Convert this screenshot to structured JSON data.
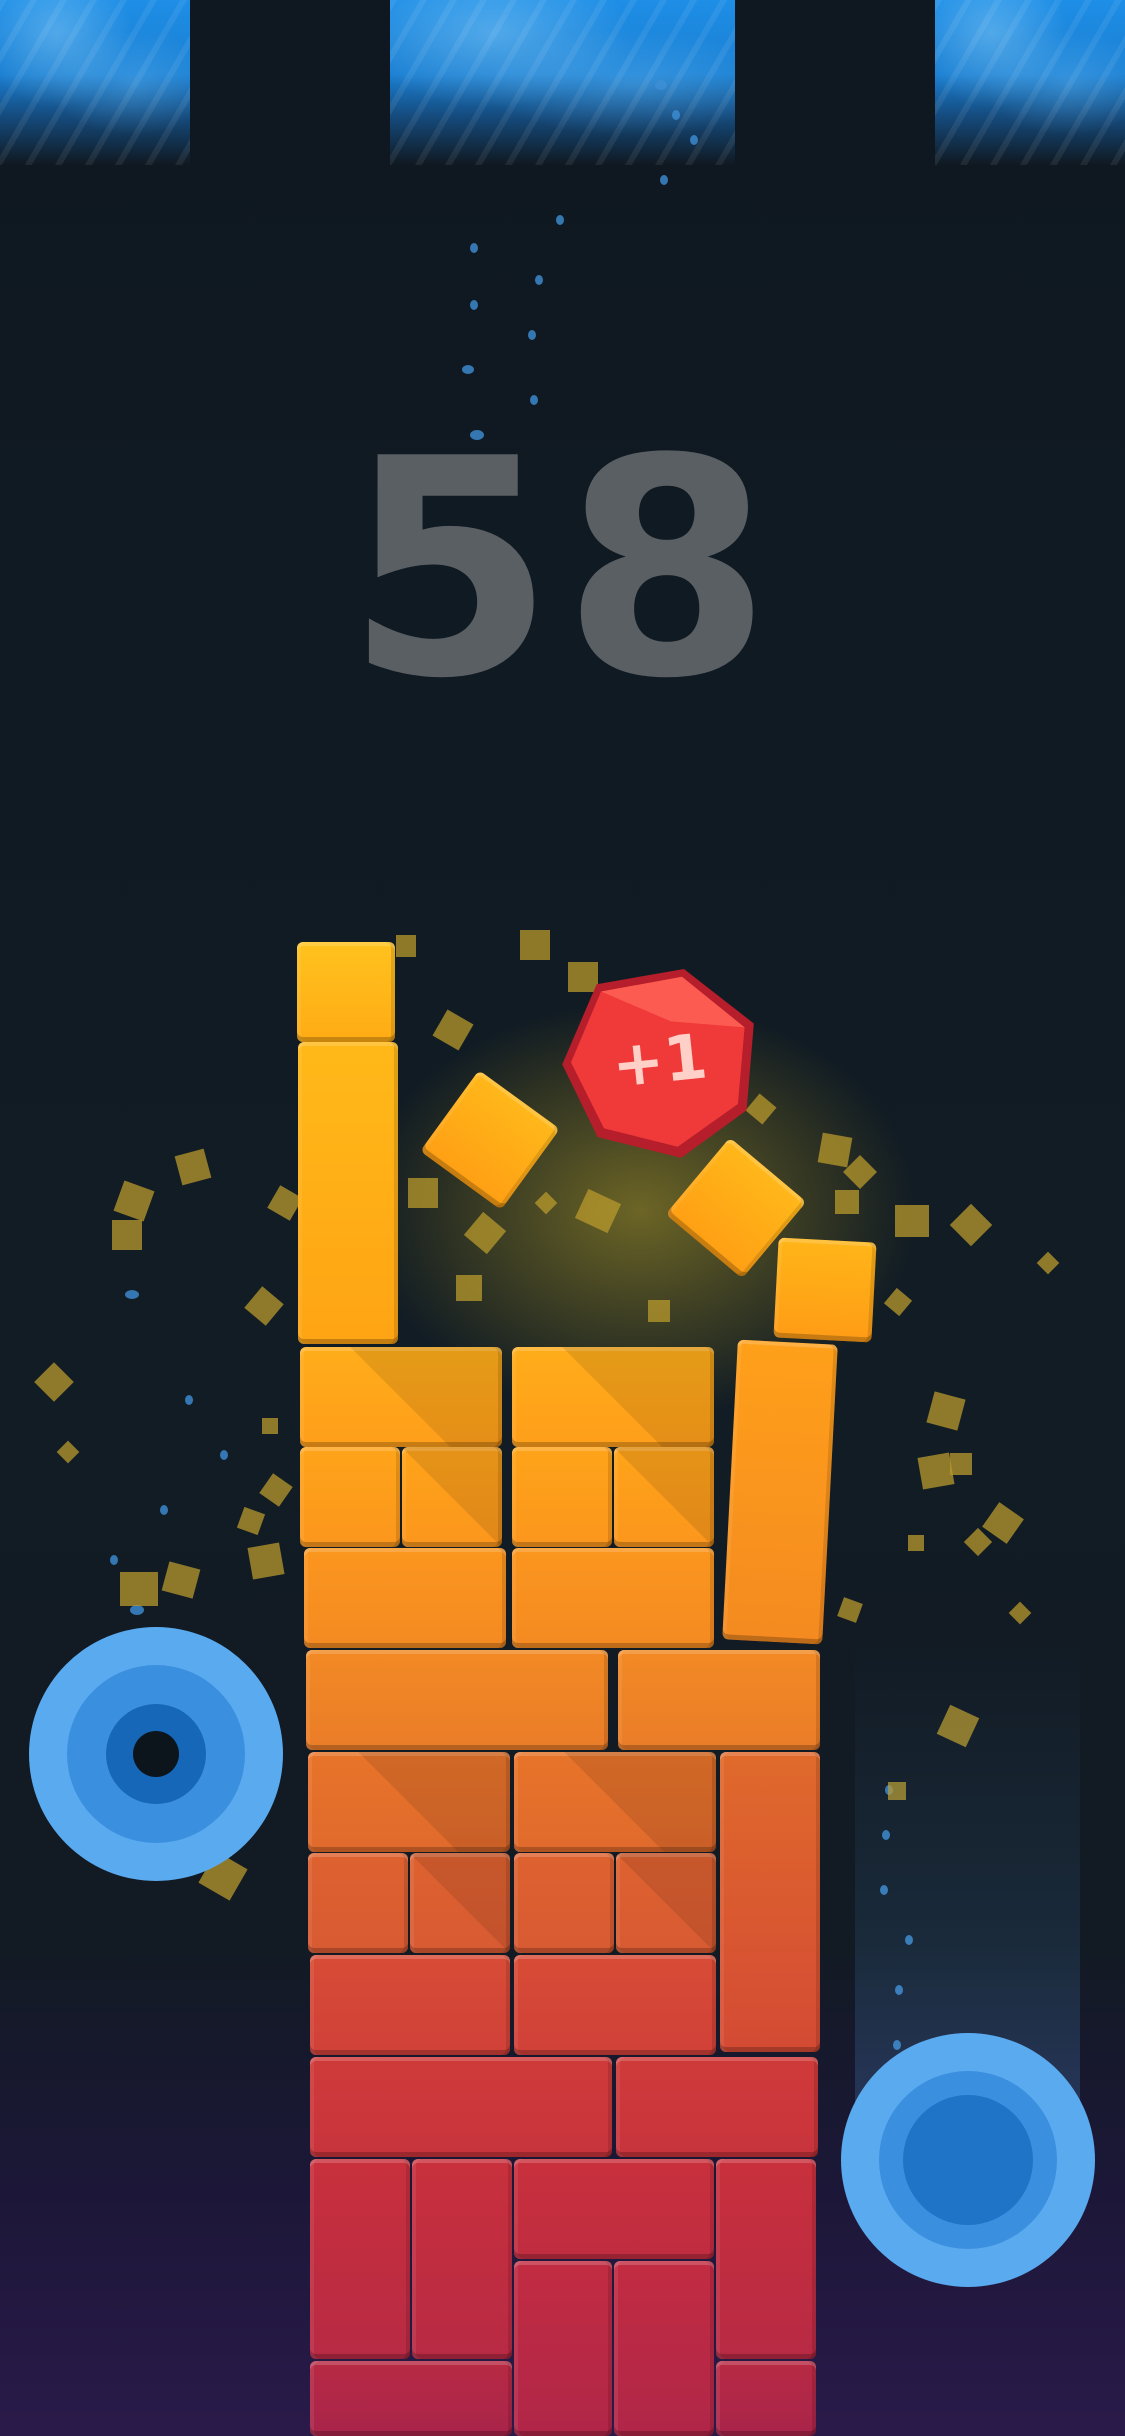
{
  "game": {
    "score": "58",
    "bonus_label": "+1"
  },
  "colors": {
    "background": "#101a22",
    "water": "#1e8ee6",
    "score_text": "#5a5f64",
    "gem": "#f03a3a",
    "control_ring": "#5aaaf0",
    "control_core": "#1767b8",
    "brick_top": "#ffb020",
    "brick_bottom": "#c0203c"
  },
  "icons": {
    "left_control": "blue-ring-button",
    "right_control": "blue-ring-button",
    "gem": "red-hexagon-gem"
  }
}
